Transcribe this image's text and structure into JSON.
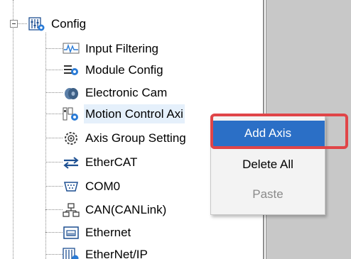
{
  "tree": {
    "root": {
      "label": "Config",
      "icon": "config-icon"
    },
    "items": [
      {
        "label": "Input Filtering",
        "icon": "input-filtering-icon"
      },
      {
        "label": "Module Config",
        "icon": "module-config-icon"
      },
      {
        "label": "Electronic Cam",
        "icon": "electronic-cam-icon"
      },
      {
        "label": "Motion Control Axi",
        "icon": "motion-control-axis-icon"
      },
      {
        "label": "Axis Group Setting",
        "icon": "axis-group-icon"
      },
      {
        "label": "EtherCAT",
        "icon": "ethercat-icon"
      },
      {
        "label": "COM0",
        "icon": "com-port-icon"
      },
      {
        "label": "CAN(CANLink)",
        "icon": "can-network-icon"
      },
      {
        "label": "Ethernet",
        "icon": "ethernet-icon"
      },
      {
        "label": "EtherNet/IP",
        "icon": "ethernet-ip-icon"
      }
    ]
  },
  "context_menu": {
    "items": [
      {
        "label": "Add Axis",
        "state": "highlighted"
      },
      {
        "label": "Delete All",
        "state": "enabled"
      },
      {
        "label": "Paste",
        "state": "disabled"
      }
    ]
  },
  "colors": {
    "menu_highlight": "#2b6fc6",
    "annotation_frame": "#e04548",
    "right_panel": "#c8c8c8"
  }
}
